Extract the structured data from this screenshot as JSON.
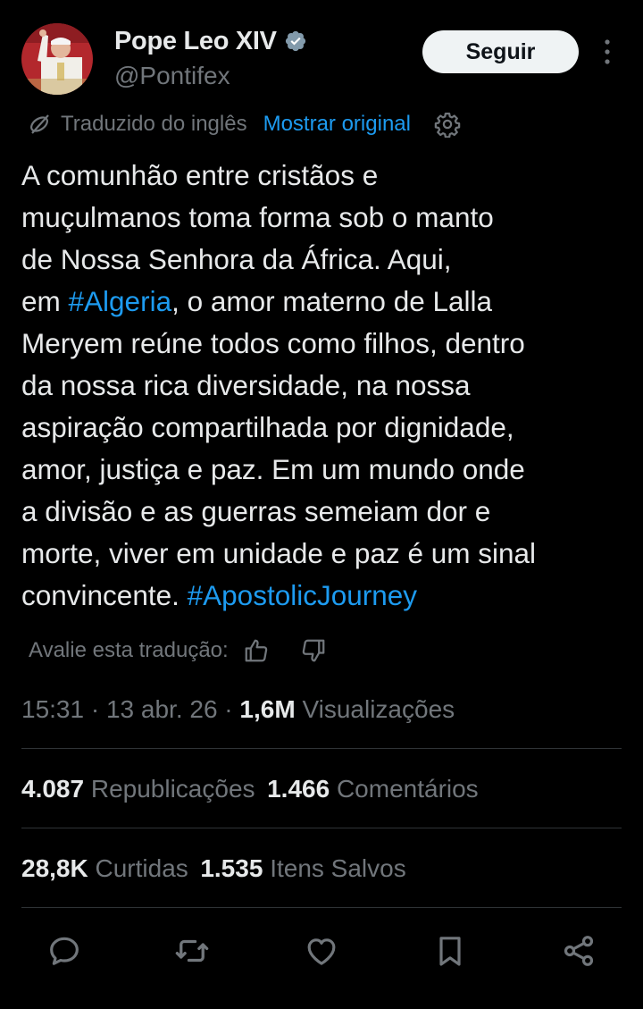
{
  "author": {
    "display_name": "Pope Leo XIV",
    "handle": "@Pontifex",
    "verified_badge": "verified-badge-icon",
    "follow_label": "Seguir"
  },
  "translation": {
    "notice": "Traduzido do inglês",
    "show_original": "Mostrar original"
  },
  "tweet": {
    "text_1": "A comunhão entre cristãos e\nmuçulmanos toma forma sob o manto\nde Nossa Senhora da África. Aqui,\nem ",
    "hashtag_1": "#Algeria",
    "text_2": ", o amor materno de Lalla\nMeryem reúne todos como filhos, dentro\nda nossa rica diversidade, na nossa\naspiração compartilhada por dignidade,\namor, justiça e paz. Em um mundo onde\na divisão e as guerras semeiam dor e\nmorte, viver em unidade e paz é um sinal\nconvincente. ",
    "hashtag_2": "#ApostolicJourney"
  },
  "rate": {
    "label": "Avalie esta tradução:"
  },
  "meta": {
    "time": "15:31",
    "date": "13 abr. 26",
    "views_count": "1,6M",
    "views_label": "Visualizações"
  },
  "stats": {
    "reposts_count": "4.087",
    "reposts_label": "Republicações",
    "comments_count": "1.466",
    "comments_label": "Comentários",
    "likes_count": "28,8K",
    "likes_label": "Curtidas",
    "saves_count": "1.535",
    "saves_label": "Itens Salvos"
  },
  "colors": {
    "background": "#000000",
    "text": "#e7e9ea",
    "muted": "#71767b",
    "accent": "#1d9bf0",
    "divider": "#2f3336"
  },
  "icons": [
    "avatar-image",
    "verified-badge-icon",
    "more-icon",
    "translate-icon",
    "settings-gear-icon",
    "thumbs-up-icon",
    "thumbs-down-icon",
    "reply-icon",
    "repost-icon",
    "like-icon",
    "bookmark-icon",
    "share-icon"
  ]
}
